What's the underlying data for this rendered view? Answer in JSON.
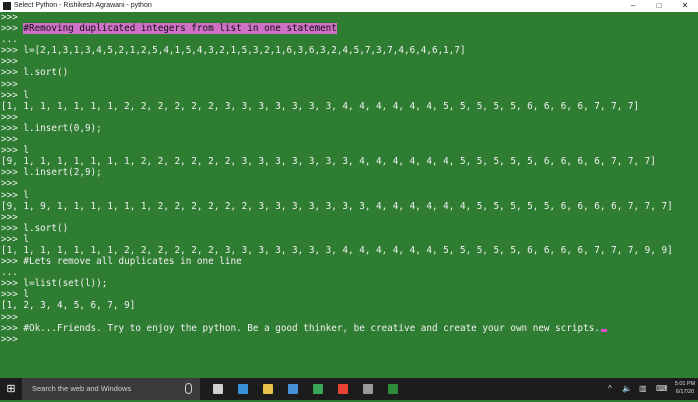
{
  "window": {
    "title": "Select Python - Rishikesh Agrawani - python",
    "minimize_glyph": "–",
    "maximize_glyph": "□",
    "close_glyph": "✕"
  },
  "console": {
    "lines": [
      {
        "text": ">>>"
      },
      {
        "prompt": ">>> ",
        "highlight": "#Removing duplicated integers from list in one statement"
      },
      {
        "text": "..."
      },
      {
        "text": ">>> l=[2,1,3,1,3,4,5,2,1,2,5,4,1,5,4,3,2,1,5,3,2,1,6,3,6,3,2,4,5,7,3,7,4,6,4,6,1,7]"
      },
      {
        "text": ">>>"
      },
      {
        "text": ">>> l.sort()"
      },
      {
        "text": ">>>"
      },
      {
        "text": ">>> l"
      },
      {
        "text": "[1, 1, 1, 1, 1, 1, 1, 2, 2, 2, 2, 2, 2, 3, 3, 3, 3, 3, 3, 3, 4, 4, 4, 4, 4, 4, 5, 5, 5, 5, 5, 6, 6, 6, 6, 7, 7, 7]"
      },
      {
        "text": ">>>"
      },
      {
        "text": ">>> l.insert(0,9);"
      },
      {
        "text": ">>>"
      },
      {
        "text": ">>> l"
      },
      {
        "text": "[9, 1, 1, 1, 1, 1, 1, 1, 2, 2, 2, 2, 2, 2, 3, 3, 3, 3, 3, 3, 3, 4, 4, 4, 4, 4, 4, 5, 5, 5, 5, 5, 6, 6, 6, 6, 7, 7, 7]"
      },
      {
        "text": ">>> l.insert(2,9);"
      },
      {
        "text": ">>>"
      },
      {
        "text": ">>> l"
      },
      {
        "text": "[9, 1, 9, 1, 1, 1, 1, 1, 1, 2, 2, 2, 2, 2, 2, 3, 3, 3, 3, 3, 3, 3, 4, 4, 4, 4, 4, 4, 5, 5, 5, 5, 5, 6, 6, 6, 6, 7, 7, 7]"
      },
      {
        "text": ">>>"
      },
      {
        "text": ">>> l.sort()"
      },
      {
        "text": ">>> l"
      },
      {
        "text": "[1, 1, 1, 1, 1, 1, 1, 2, 2, 2, 2, 2, 2, 3, 3, 3, 3, 3, 3, 3, 4, 4, 4, 4, 4, 4, 5, 5, 5, 5, 5, 6, 6, 6, 6, 7, 7, 7, 9, 9]"
      },
      {
        "text": ">>> #Lets remove all duplicates in one line"
      },
      {
        "text": "..."
      },
      {
        "text": ">>> l=list(set(l));"
      },
      {
        "text": ">>> l"
      },
      {
        "text": "[1, 2, 3, 4, 5, 6, 7, 9]"
      },
      {
        "text": ">>>"
      },
      {
        "text": ">>> #Ok...Friends. Try to enjoy the python. Be a good thinker, be creative and create your own new scripts.",
        "cursor": true
      },
      {
        "text": ">>>"
      }
    ]
  },
  "taskbar": {
    "start_glyph": "⊞",
    "search_placeholder": "Search the web and Windows",
    "apps": [
      {
        "name": "task-view-icon",
        "color": "#cfcfcf"
      },
      {
        "name": "edge-icon",
        "color": "#3a8fd9"
      },
      {
        "name": "file-explorer-icon",
        "color": "#e8c14a"
      },
      {
        "name": "store-icon",
        "color": "#4a90d9"
      },
      {
        "name": "app-green-icon",
        "color": "#3aa655"
      },
      {
        "name": "chrome-icon",
        "color": "#e94335"
      },
      {
        "name": "cmd-icon",
        "color": "#9a9a9a"
      },
      {
        "name": "excel-icon",
        "color": "#2e8b3a"
      }
    ],
    "tray": {
      "chevron": "^",
      "volume": "🔈",
      "network": "▥",
      "keyboard": "⌨"
    },
    "clock_time": "5:01 PM",
    "clock_date": "6/17/20"
  }
}
